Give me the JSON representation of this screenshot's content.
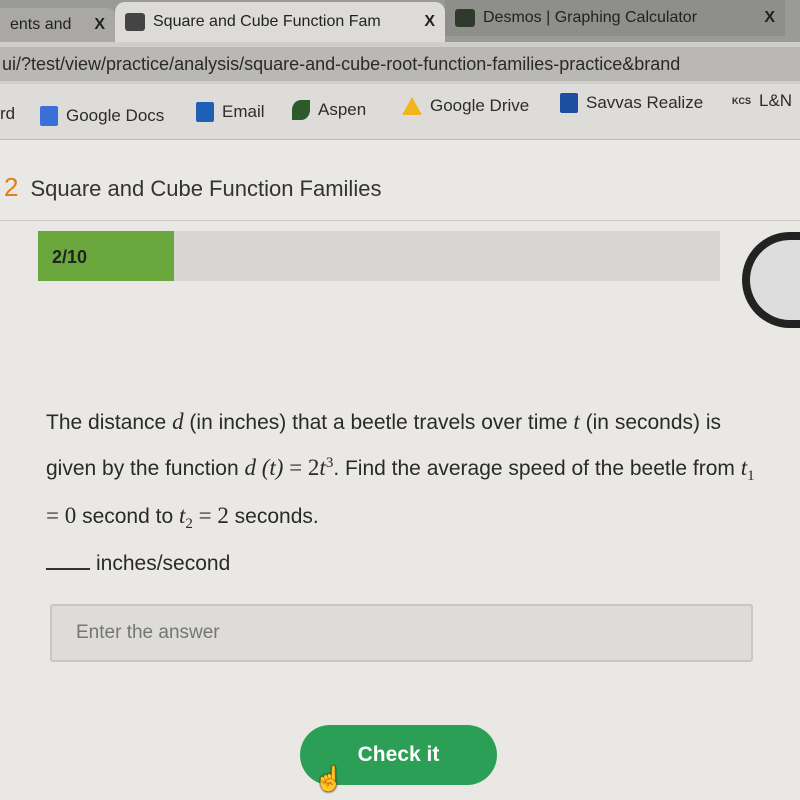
{
  "browser": {
    "tabs": [
      {
        "label": "ents and",
        "close": "X"
      },
      {
        "label": "Square and Cube Function Fam",
        "close": "X",
        "active": true
      },
      {
        "label": "Desmos | Graphing Calculator",
        "close": "X"
      }
    ],
    "url": "ui/?test/view/practice/analysis/square-and-cube-root-function-families-practice&brand",
    "bookmarks": [
      {
        "label": "rd"
      },
      {
        "label": "Google Docs",
        "icon": "google-docs-icon",
        "color": "#3b6fd8"
      },
      {
        "label": "Email",
        "icon": "outlook-icon",
        "color": "#1f5fb5"
      },
      {
        "label": "Aspen",
        "icon": "aspen-leaf-icon",
        "color": "#2d5a2a"
      },
      {
        "label": "Google Drive",
        "icon": "google-drive-icon",
        "color": "#f2b51c"
      },
      {
        "label": "Savvas Realize",
        "icon": "savvas-icon",
        "color": "#1d4fa0"
      },
      {
        "label": "L&N",
        "icon": "kcs-icon",
        "badge": "KCS"
      }
    ]
  },
  "lesson": {
    "number": "2",
    "title": "Square and Cube Function Families"
  },
  "progress": {
    "label": "2/10",
    "current": 2,
    "total": 10,
    "color": "#6aa83d"
  },
  "question": {
    "p1": "The distance ",
    "d": "d",
    "p2": " (in inches) that a beetle travels over time ",
    "t": "t",
    "p3": " (in seconds) is given by the function ",
    "func": "d (t)",
    "eq": " = 2",
    "t2": "t",
    "exp": "3",
    "p4": ". Find the average speed of the beetle from ",
    "t1": "t",
    "sub1": "1",
    "eq0": " = 0",
    "p5": " second to ",
    "t2b": "t",
    "sub2": "2",
    "eq2": " = 2",
    "p6": " seconds.",
    "unit": "inches/second"
  },
  "answer": {
    "placeholder": "Enter the answer",
    "value": ""
  },
  "check_button": "Check it",
  "colors": {
    "accent": "#2c9f56",
    "lesson_number": "#d9821d"
  }
}
